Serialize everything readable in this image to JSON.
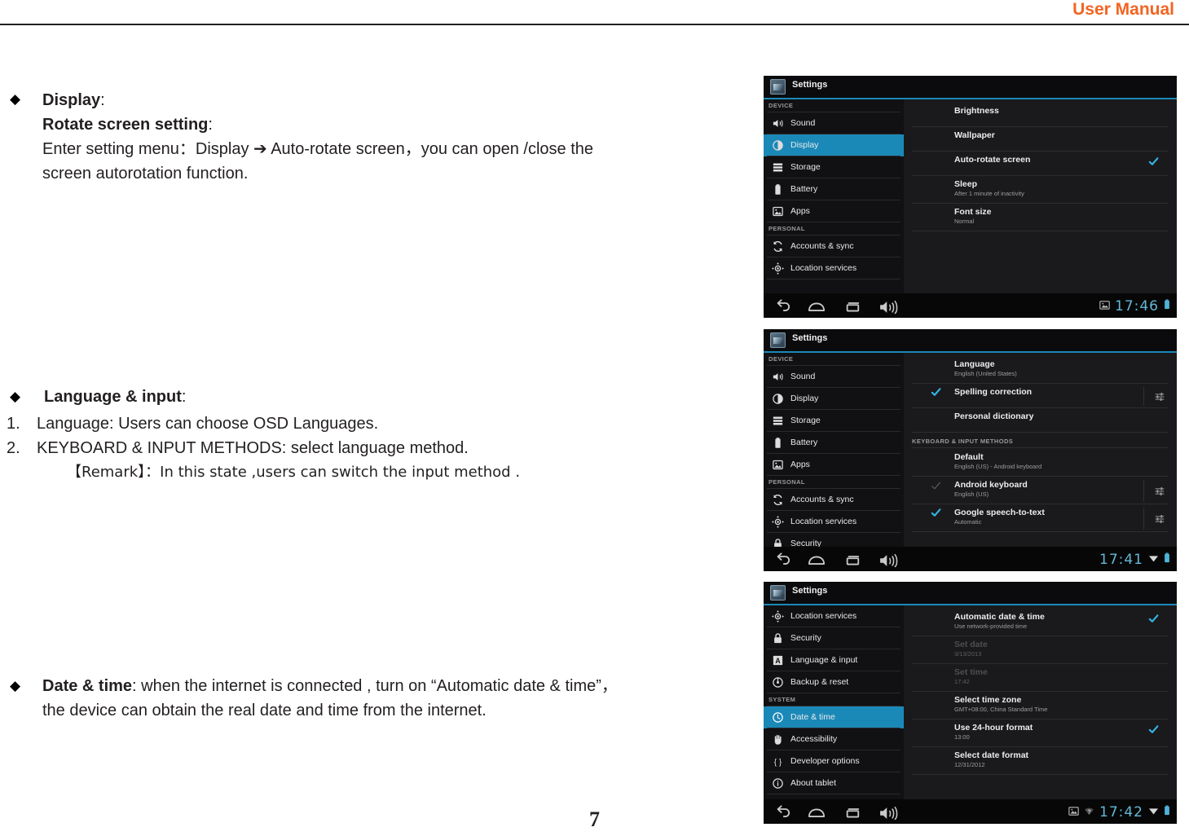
{
  "header": {
    "title": "User Manual"
  },
  "page_number": "7",
  "sections": {
    "display": {
      "bullet": "◆",
      "heading": "Display",
      "heading_colon": ":",
      "subheading": "Rotate screen setting",
      "subheading_colon": ":",
      "line1": "Enter setting menu：Display ➔ Auto-rotate screen，you can open /close the",
      "line2": "screen autorotation function."
    },
    "language": {
      "bullet": "◆",
      "heading": "Language & input",
      "heading_colon": ":",
      "item1_num": "1.",
      "item1": "Language: Users can choose OSD Languages.",
      "item2_num": "2.",
      "item2": "KEYBOARD & INPUT METHODS: select language method.",
      "item3": "【Remark】：In this state ,users can switch the input method ."
    },
    "date_time": {
      "bullet": "◆",
      "heading": "Date & time",
      "line1_rest": ": when the internet is connected , turn on “Automatic date & time”，",
      "line2": "the device can obtain the real date and time from the internet."
    }
  },
  "colors": {
    "brand_orange": "#f26522",
    "android_accent": "#1b89b8",
    "clock_cyan": "#63b8d8",
    "checkbox_blue": "#33b5e5"
  },
  "screenshots": [
    {
      "name": "display-settings",
      "app_title": "Settings",
      "sidebar": [
        {
          "type": "group",
          "label": "DEVICE"
        },
        {
          "type": "item",
          "icon": "sound-icon",
          "label": "Sound",
          "selected": false
        },
        {
          "type": "item",
          "icon": "display-icon",
          "label": "Display",
          "selected": true
        },
        {
          "type": "item",
          "icon": "storage-icon",
          "label": "Storage",
          "selected": false
        },
        {
          "type": "item",
          "icon": "battery-icon",
          "label": "Battery",
          "selected": false
        },
        {
          "type": "item",
          "icon": "apps-icon",
          "label": "Apps",
          "selected": false
        },
        {
          "type": "group",
          "label": "PERSONAL"
        },
        {
          "type": "item",
          "icon": "accounts-sync-icon",
          "label": "Accounts & sync",
          "selected": false
        },
        {
          "type": "item",
          "icon": "location-icon",
          "label": "Location services",
          "selected": false
        }
      ],
      "content": [
        {
          "title": "Brightness",
          "sub": "",
          "checkbox": "none",
          "slider": false
        },
        {
          "title": "Wallpaper",
          "sub": "",
          "checkbox": "none",
          "slider": false
        },
        {
          "title": "Auto-rotate screen",
          "sub": "",
          "checkbox": "checked-right",
          "slider": false
        },
        {
          "title": "Sleep",
          "sub": "After 1 minute of inactivity",
          "checkbox": "none",
          "slider": false
        },
        {
          "title": "Font size",
          "sub": "Normal",
          "checkbox": "none",
          "slider": false
        }
      ],
      "navbar": [
        "back-icon",
        "home-icon",
        "recents-icon",
        "volume-icon"
      ],
      "status": {
        "screenshot_icon": true,
        "wifi_icon": false,
        "clock": "17:46",
        "signal_icon": false,
        "battery_icon": true
      }
    },
    {
      "name": "language-input-settings",
      "app_title": "Settings",
      "sidebar": [
        {
          "type": "group",
          "label": "DEVICE"
        },
        {
          "type": "item",
          "icon": "sound-icon",
          "label": "Sound",
          "selected": false
        },
        {
          "type": "item",
          "icon": "display-icon",
          "label": "Display",
          "selected": false
        },
        {
          "type": "item",
          "icon": "storage-icon",
          "label": "Storage",
          "selected": false
        },
        {
          "type": "item",
          "icon": "battery-icon",
          "label": "Battery",
          "selected": false
        },
        {
          "type": "item",
          "icon": "apps-icon",
          "label": "Apps",
          "selected": false
        },
        {
          "type": "group",
          "label": "PERSONAL"
        },
        {
          "type": "item",
          "icon": "accounts-sync-icon",
          "label": "Accounts & sync",
          "selected": false
        },
        {
          "type": "item",
          "icon": "location-icon",
          "label": "Location services",
          "selected": false
        },
        {
          "type": "item",
          "icon": "security-lock-icon",
          "label": "Security",
          "selected": false
        }
      ],
      "content": [
        {
          "title": "Language",
          "sub": "English (United States)",
          "checkbox": "none",
          "slider": false
        },
        {
          "title": "Spelling correction",
          "sub": "",
          "checkbox": "checked-left",
          "slider": true
        },
        {
          "title": "Personal dictionary",
          "sub": "",
          "checkbox": "none",
          "slider": false
        },
        {
          "type": "group",
          "title": "KEYBOARD & INPUT METHODS"
        },
        {
          "title": "Default",
          "sub": "English (US) - Android keyboard",
          "checkbox": "none",
          "slider": false
        },
        {
          "title": "Android keyboard",
          "sub": "English (US)",
          "checkbox": "dim-left",
          "slider": true
        },
        {
          "title": "Google speech-to-text",
          "sub": "Automatic",
          "checkbox": "checked-left",
          "slider": true
        }
      ],
      "navbar": [
        "back-icon",
        "home-icon",
        "recents-icon",
        "volume-icon"
      ],
      "status": {
        "screenshot_icon": false,
        "wifi_icon": false,
        "clock": "17:41",
        "signal_icon": true,
        "battery_icon": true
      }
    },
    {
      "name": "date-time-settings",
      "app_title": "Settings",
      "sidebar": [
        {
          "type": "item",
          "icon": "location-icon",
          "label": "Location services",
          "selected": false
        },
        {
          "type": "item",
          "icon": "security-lock-icon",
          "label": "Security",
          "selected": false
        },
        {
          "type": "item",
          "icon": "language-input-icon",
          "label": "Language & input",
          "selected": false
        },
        {
          "type": "item",
          "icon": "backup-reset-icon",
          "label": "Backup & reset",
          "selected": false
        },
        {
          "type": "group",
          "label": "SYSTEM"
        },
        {
          "type": "item",
          "icon": "clock-icon",
          "label": "Date & time",
          "selected": true
        },
        {
          "type": "item",
          "icon": "accessibility-hand-icon",
          "label": "Accessibility",
          "selected": false
        },
        {
          "type": "item",
          "icon": "developer-options-icon",
          "label": "Developer options",
          "selected": false
        },
        {
          "type": "item",
          "icon": "about-tablet-icon",
          "label": "About tablet",
          "selected": false
        }
      ],
      "content": [
        {
          "title": "Automatic date & time",
          "sub": "Use network-provided time",
          "checkbox": "checked-right",
          "slider": false
        },
        {
          "title": "Set date",
          "sub": "3/13/2013",
          "checkbox": "none",
          "slider": false,
          "dim": true
        },
        {
          "title": "Set time",
          "sub": "17:42",
          "checkbox": "none",
          "slider": false,
          "dim": true
        },
        {
          "title": "Select time zone",
          "sub": "GMT+08:00, China Standard Time",
          "checkbox": "none",
          "slider": false
        },
        {
          "title": "Use 24-hour format",
          "sub": "13:00",
          "checkbox": "checked-right",
          "slider": false
        },
        {
          "title": "Select date format",
          "sub": "12/31/2012",
          "checkbox": "none",
          "slider": false
        }
      ],
      "navbar": [
        "back-icon",
        "home-icon",
        "recents-icon",
        "volume-icon"
      ],
      "status": {
        "screenshot_icon": true,
        "wifi_icon": true,
        "clock": "17:42",
        "signal_icon": true,
        "battery_icon": true
      }
    }
  ]
}
